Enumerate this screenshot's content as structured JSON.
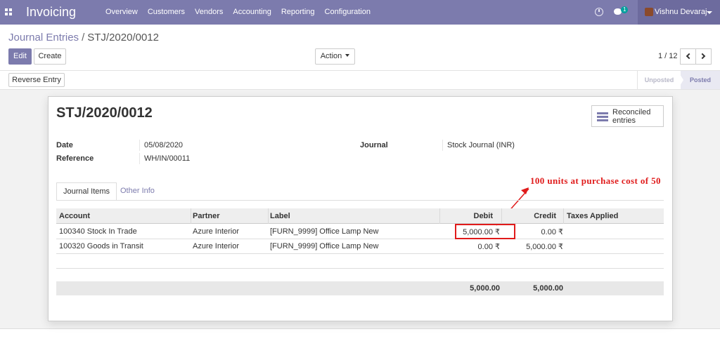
{
  "navbar": {
    "brand": "Invoicing",
    "menu": [
      "Overview",
      "Customers",
      "Vendors",
      "Accounting",
      "Reporting",
      "Configuration"
    ],
    "chat_count": "1",
    "user_name": "Vishnu Devaraj"
  },
  "breadcrumb": {
    "parent": "Journal Entries",
    "separator": "/",
    "current": "STJ/2020/0012"
  },
  "buttons": {
    "edit": "Edit",
    "create": "Create",
    "action": "Action",
    "reverse_entry": "Reverse Entry"
  },
  "pager": {
    "value": "1 / 12"
  },
  "status": {
    "unposted": "Unposted",
    "posted": "Posted",
    "current": "Posted"
  },
  "record": {
    "title": "STJ/2020/0012",
    "reconciled_label_1": "Reconciled",
    "reconciled_label_2": "entries",
    "date_label": "Date",
    "date_value": "05/08/2020",
    "reference_label": "Reference",
    "reference_value": "WH/IN/00011",
    "journal_label": "Journal",
    "journal_value": "Stock Journal (INR)"
  },
  "annotation": "100 units at purchase cost of 50",
  "tabs": {
    "journal_items": "Journal Items",
    "other_info": "Other Info",
    "active": "Journal Items"
  },
  "table": {
    "headers": {
      "account": "Account",
      "partner": "Partner",
      "label": "Label",
      "debit": "Debit",
      "credit": "Credit",
      "taxes": "Taxes Applied"
    },
    "rows": [
      {
        "account": "100340 Stock In Trade",
        "partner": "Azure Interior",
        "label": "[FURN_9999] Office Lamp New",
        "debit": "5,000.00 ₹",
        "credit": "0.00 ₹",
        "taxes": ""
      },
      {
        "account": "100320 Goods in Transit",
        "partner": "Azure Interior",
        "label": "[FURN_9999] Office Lamp New",
        "debit": "0.00 ₹",
        "credit": "5,000.00 ₹",
        "taxes": ""
      }
    ],
    "totals": {
      "debit": "5,000.00",
      "credit": "5,000.00"
    }
  },
  "colors": {
    "brand": "#7c7bad",
    "annotation": "#e01b1b"
  }
}
